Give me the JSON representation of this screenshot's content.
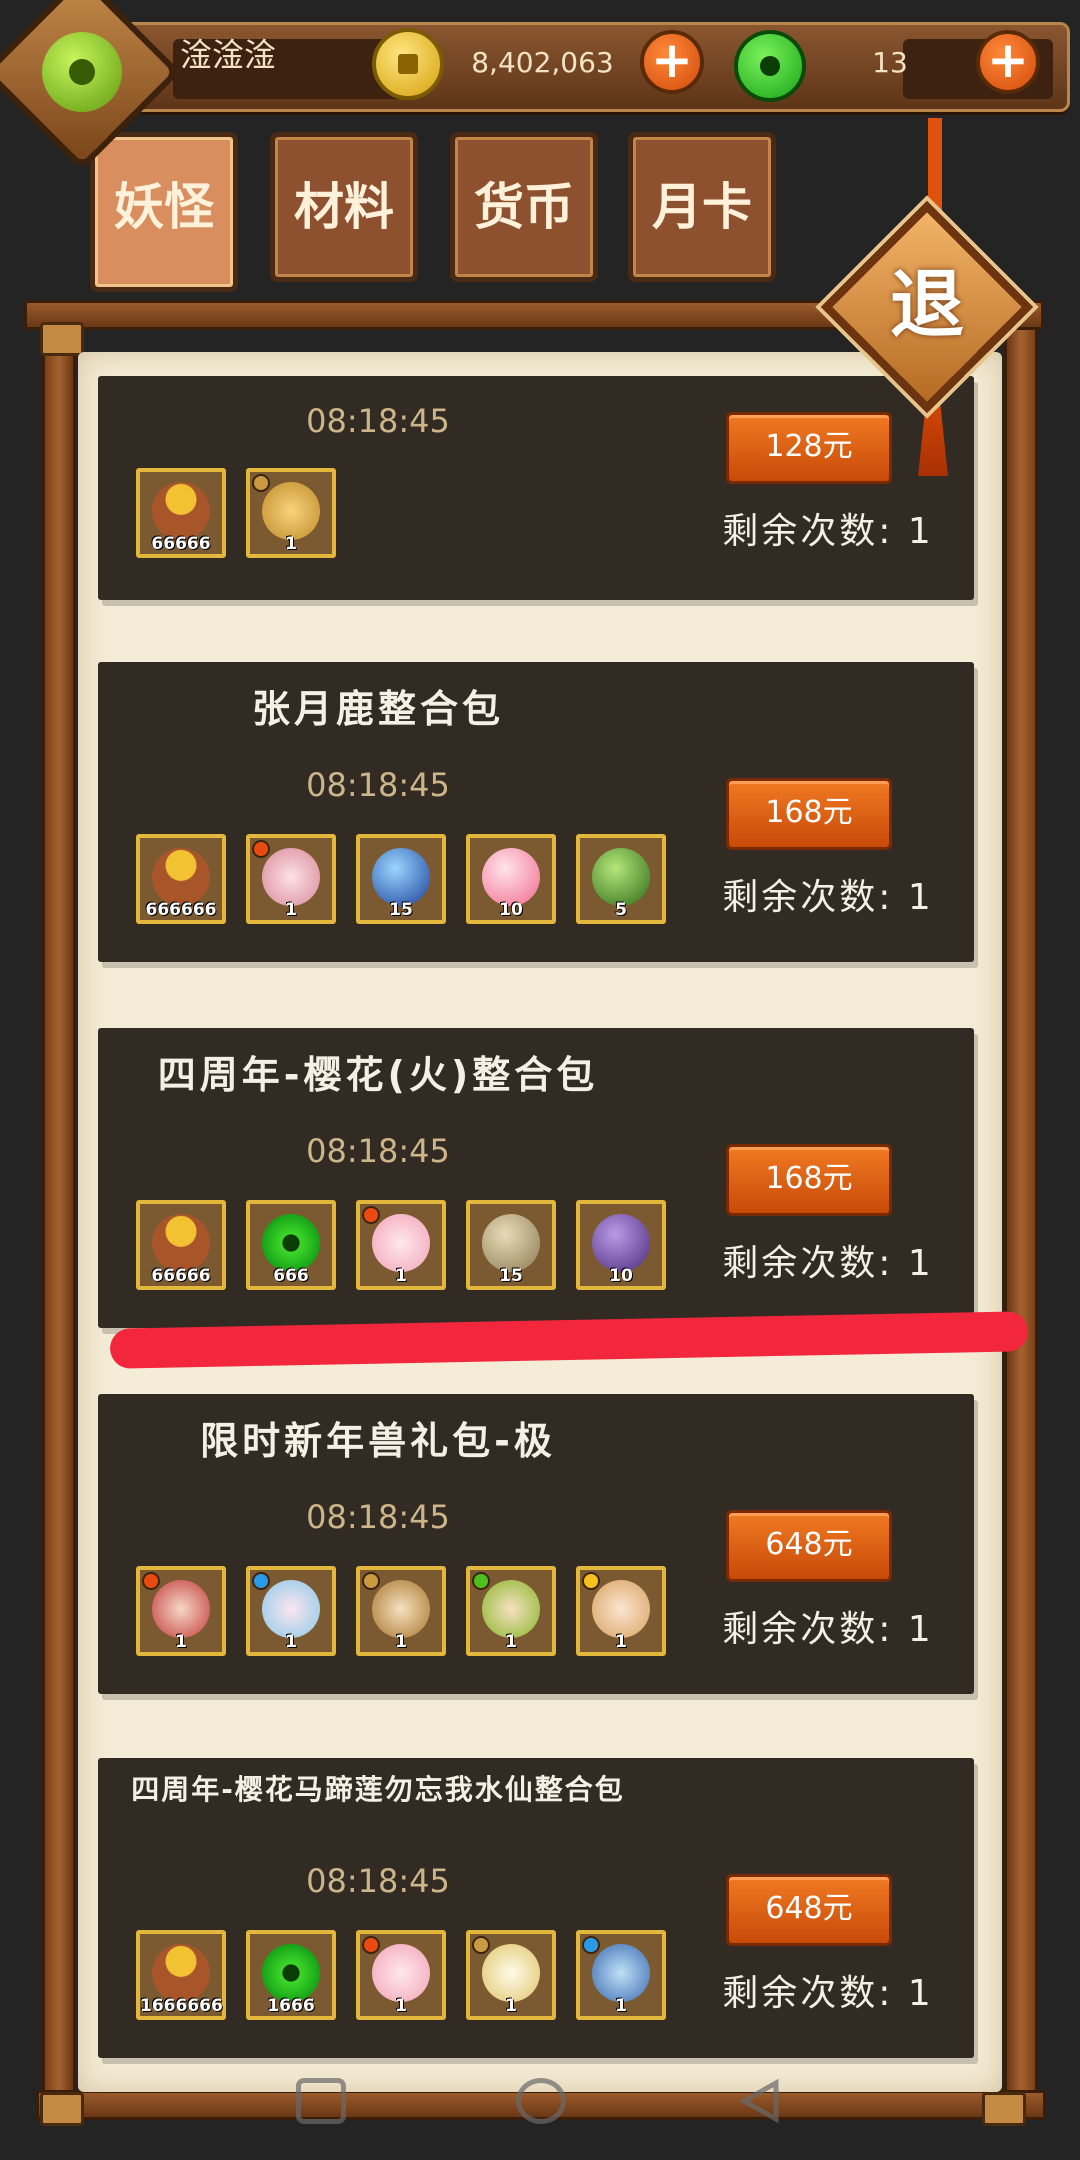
{
  "header": {
    "username": "淦淦淦",
    "gold": "8,402,063",
    "jade": "13"
  },
  "tabs": [
    {
      "label": "妖怪",
      "active": true
    },
    {
      "label": "材料",
      "active": false
    },
    {
      "label": "货币",
      "active": false
    },
    {
      "label": "月卡",
      "active": false
    }
  ],
  "exit_label": "退",
  "packs": [
    {
      "title": "",
      "timer": "08:18:45",
      "price": "128元",
      "remaining": "剩余次数: 1",
      "items": [
        {
          "icon": "gold-bag-icon",
          "qty": "66666"
        },
        {
          "icon": "leo-star-icon",
          "qty": "1",
          "badge": "#c99a40"
        }
      ]
    },
    {
      "title": "张月鹿整合包",
      "timer": "08:18:45",
      "price": "168元",
      "remaining": "剩余次数: 1",
      "items": [
        {
          "icon": "gold-bag-icon",
          "qty": "666666"
        },
        {
          "icon": "pink-deer-monster-icon",
          "qty": "1",
          "badge": "#e84a10"
        },
        {
          "icon": "blue-orb-icon",
          "qty": "15"
        },
        {
          "icon": "pink-heart-orb-icon",
          "qty": "10"
        },
        {
          "icon": "green-orb-icon",
          "qty": "5"
        }
      ]
    },
    {
      "title": "四周年-樱花(火)整合包",
      "timer": "08:18:45",
      "price": "168元",
      "remaining": "剩余次数: 1",
      "items": [
        {
          "icon": "gold-bag-icon",
          "qty": "66666"
        },
        {
          "icon": "jade-coin-icon",
          "qty": "666"
        },
        {
          "icon": "sakura-monster-icon",
          "qty": "1",
          "badge": "#e84a10"
        },
        {
          "icon": "stone-orb-icon",
          "qty": "15"
        },
        {
          "icon": "purple-orb-icon",
          "qty": "10"
        }
      ]
    },
    {
      "title": "限时新年兽礼包-极",
      "timer": "08:18:45",
      "price": "648元",
      "remaining": "剩余次数: 1",
      "items": [
        {
          "icon": "fire-nian-beast-icon",
          "qty": "1",
          "badge": "#e84a10"
        },
        {
          "icon": "water-nian-beast-icon",
          "qty": "1",
          "badge": "#2a9ae8"
        },
        {
          "icon": "earth-nian-beast-icon",
          "qty": "1",
          "badge": "#c99a40"
        },
        {
          "icon": "wood-nian-beast-icon",
          "qty": "1",
          "badge": "#4cc11e"
        },
        {
          "icon": "light-nian-beast-icon",
          "qty": "1",
          "badge": "#f5c21c"
        }
      ]
    },
    {
      "title": "四周年-樱花马蹄莲勿忘我水仙整合包",
      "timer": "08:18:45",
      "price": "648元",
      "remaining": "剩余次数: 1",
      "items": [
        {
          "icon": "gold-bag-icon",
          "qty": "1666666"
        },
        {
          "icon": "jade-coin-icon",
          "qty": "1666"
        },
        {
          "icon": "sakura-monster-icon",
          "qty": "1",
          "badge": "#e84a10"
        },
        {
          "icon": "calla-lily-monster-icon",
          "qty": "1",
          "badge": "#c99a40"
        },
        {
          "icon": "forget-me-not-monster-icon",
          "qty": "1",
          "badge": "#2a9ae8"
        }
      ]
    }
  ],
  "colors": {
    "accent_orange": "#e0650f",
    "card_bg": "#312b23",
    "paper_bg": "#f4ecd6",
    "item_border": "#e3b63c",
    "red_mark": "#f2263d"
  },
  "system_nav": {
    "icons": [
      "recent-apps-icon",
      "home-icon",
      "back-icon"
    ]
  }
}
